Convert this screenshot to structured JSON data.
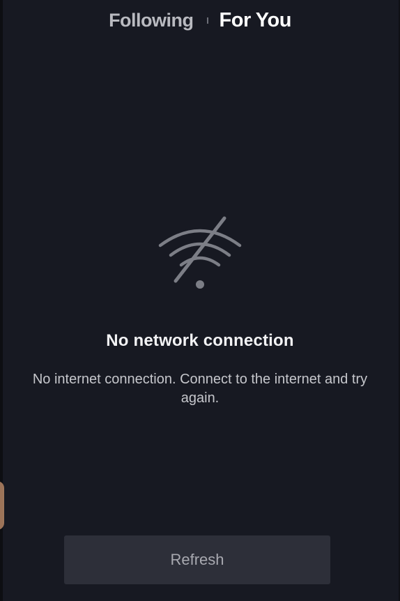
{
  "header": {
    "tabs": [
      {
        "id": "following",
        "label": "Following",
        "active": false
      },
      {
        "id": "for_you",
        "label": "For You",
        "active": true
      }
    ]
  },
  "empty_state": {
    "icon": "wifi-off-icon",
    "title": "No network connection",
    "message": "No internet connection. Connect to the internet and try again."
  },
  "actions": {
    "refresh_label": "Refresh"
  },
  "colors": {
    "background": "#171922",
    "button_bg": "#2d2f39",
    "icon": "#7c7e86",
    "active_tab": "#ffffff",
    "inactive_tab": "#b9bac0"
  }
}
